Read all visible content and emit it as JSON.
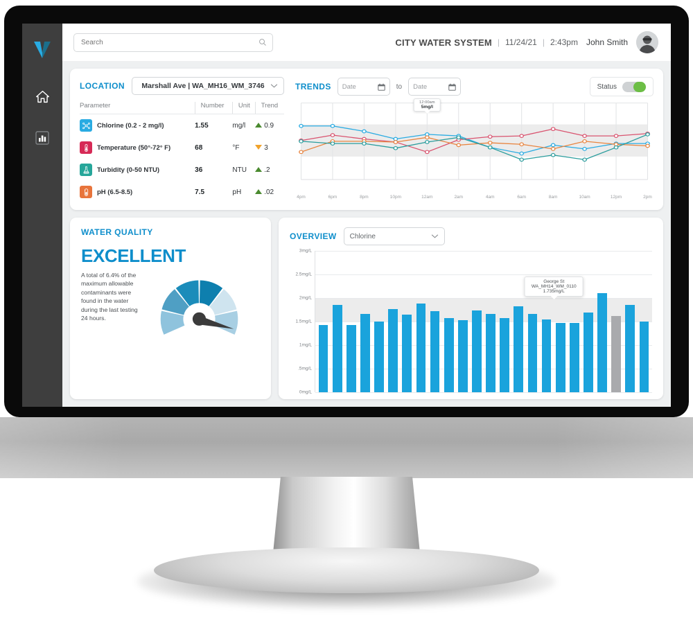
{
  "sidebar": {
    "logo_label": "V",
    "items": [
      {
        "name": "home-icon",
        "label": "Home"
      },
      {
        "name": "reports-icon",
        "label": "Reports"
      }
    ]
  },
  "topbar": {
    "search_placeholder": "Search",
    "search_value": "",
    "search_icon": "search-icon",
    "system_title": "CITY WATER SYSTEM",
    "separator": "|",
    "date": "11/24/21",
    "time": "2:43pm",
    "user_name": "John Smith",
    "avatar_label": "JS"
  },
  "location_panel": {
    "title": "LOCATION",
    "selected_location": "Marshall Ave | WA_MH16_WM_3746",
    "dropdown_icon": "chevron-down-icon",
    "columns": [
      "Parameter",
      "Number",
      "Unit",
      "Trend"
    ],
    "rows": [
      {
        "icon": "chlorine-icon",
        "icon_color": "#29ABE2",
        "parameter": "Chlorine (0.2 - 2 mg/l)",
        "number": "1.55",
        "unit": "mg/l",
        "trend_dir": "up",
        "trend": "0.9"
      },
      {
        "icon": "temperature-icon",
        "icon_color": "#D62A56",
        "parameter": "Temperature (50°-72° F)",
        "number": "68",
        "unit": "°F",
        "trend_dir": "down",
        "trend": "3"
      },
      {
        "icon": "turbidity-icon",
        "icon_color": "#26A69A",
        "parameter": "Turbidity (0-50 NTU)",
        "number": "36",
        "unit": "NTU",
        "trend_dir": "up",
        "trend": ".2"
      },
      {
        "icon": "ph-icon",
        "icon_color": "#E8743B",
        "parameter": "pH (6.5-8.5)",
        "number": "7.5",
        "unit": "pH",
        "trend_dir": "up",
        "trend": ".02"
      }
    ]
  },
  "trends_panel": {
    "title": "TRENDS",
    "date_from_placeholder": "Date",
    "date_to_placeholder": "Date",
    "to_label": "to",
    "calendar_icon": "calendar-icon",
    "status_label": "Status",
    "status_on": true,
    "status_color": "#6cbe45",
    "tooltip": {
      "time": "12:00am",
      "value": "5mg/l"
    }
  },
  "water_quality": {
    "title": "WATER QUALITY",
    "rating": "EXCELLENT",
    "rating_color": "#0e8ecb",
    "description": "A total of 6.4% of the maximum allowable contaminants were found in the water during the last testing 24 hours.",
    "gauge_segments": [
      "#8fc3dd",
      "#4f9fc4",
      "#1b8cba",
      "#0e7fae",
      "#cfe4ef",
      "#a8cfe3"
    ]
  },
  "overview_panel": {
    "title": "OVERVIEW",
    "selected_parameter": "Chlorine",
    "dropdown_icon": "chevron-down-icon",
    "tooltip": {
      "street": "George St",
      "id": "WA_MH14_WM_0110",
      "value": "1.735mg/L"
    }
  },
  "chart_data": [
    {
      "type": "line",
      "title": "TRENDS",
      "xlabel": "",
      "ylabel": "",
      "x": [
        "4pm",
        "6pm",
        "8pm",
        "10pm",
        "12am",
        "2am",
        "4am",
        "6am",
        "8am",
        "10am",
        "12pm",
        "2pm"
      ],
      "ylim": [
        0,
        10
      ],
      "band": [
        3.0,
        7.2
      ],
      "grid": true,
      "legend": "none",
      "series": [
        {
          "name": "Chlorine",
          "color": "#29ABE2",
          "values": [
            7.0,
            7.0,
            6.3,
            5.3,
            5.9,
            5.7,
            4.2,
            3.4,
            4.5,
            4.0,
            4.7,
            4.7
          ]
        },
        {
          "name": "Temperature",
          "color": "#D9536F",
          "values": [
            5.1,
            5.8,
            5.3,
            4.9,
            3.6,
            5.2,
            5.6,
            5.7,
            6.6,
            5.7,
            5.7,
            6.0
          ]
        },
        {
          "name": "pH",
          "color": "#E8843F",
          "values": [
            3.6,
            5.0,
            5.0,
            4.9,
            5.5,
            4.5,
            4.8,
            4.6,
            4.0,
            5.0,
            4.6,
            4.4
          ]
        },
        {
          "name": "Turbidity",
          "color": "#2A9D9D",
          "values": [
            5.0,
            4.7,
            4.7,
            4.1,
            4.9,
            5.5,
            4.2,
            2.6,
            3.2,
            2.6,
            4.2,
            5.9
          ]
        }
      ]
    },
    {
      "type": "bar",
      "title": "OVERVIEW",
      "xlabel": "",
      "ylabel": "mg/L",
      "yticks": [
        "0mg/L",
        ".5mg/L",
        "1mg/L",
        "1.5mg/L",
        "2mg/L",
        "2.5mg/L",
        "3mg/L"
      ],
      "ylim": [
        0,
        3
      ],
      "band": [
        1.5,
        2.0
      ],
      "bar_color": "#1aa3dc",
      "highlight_color": "#a9aaad",
      "highlight_index": 21,
      "values": [
        1.43,
        1.86,
        1.43,
        1.66,
        1.5,
        1.76,
        1.65,
        1.88,
        1.72,
        1.58,
        1.53,
        1.74,
        1.66,
        1.57,
        1.83,
        1.66,
        1.54,
        1.47,
        1.47,
        1.69,
        2.1,
        1.62,
        1.85,
        1.5
      ]
    }
  ]
}
